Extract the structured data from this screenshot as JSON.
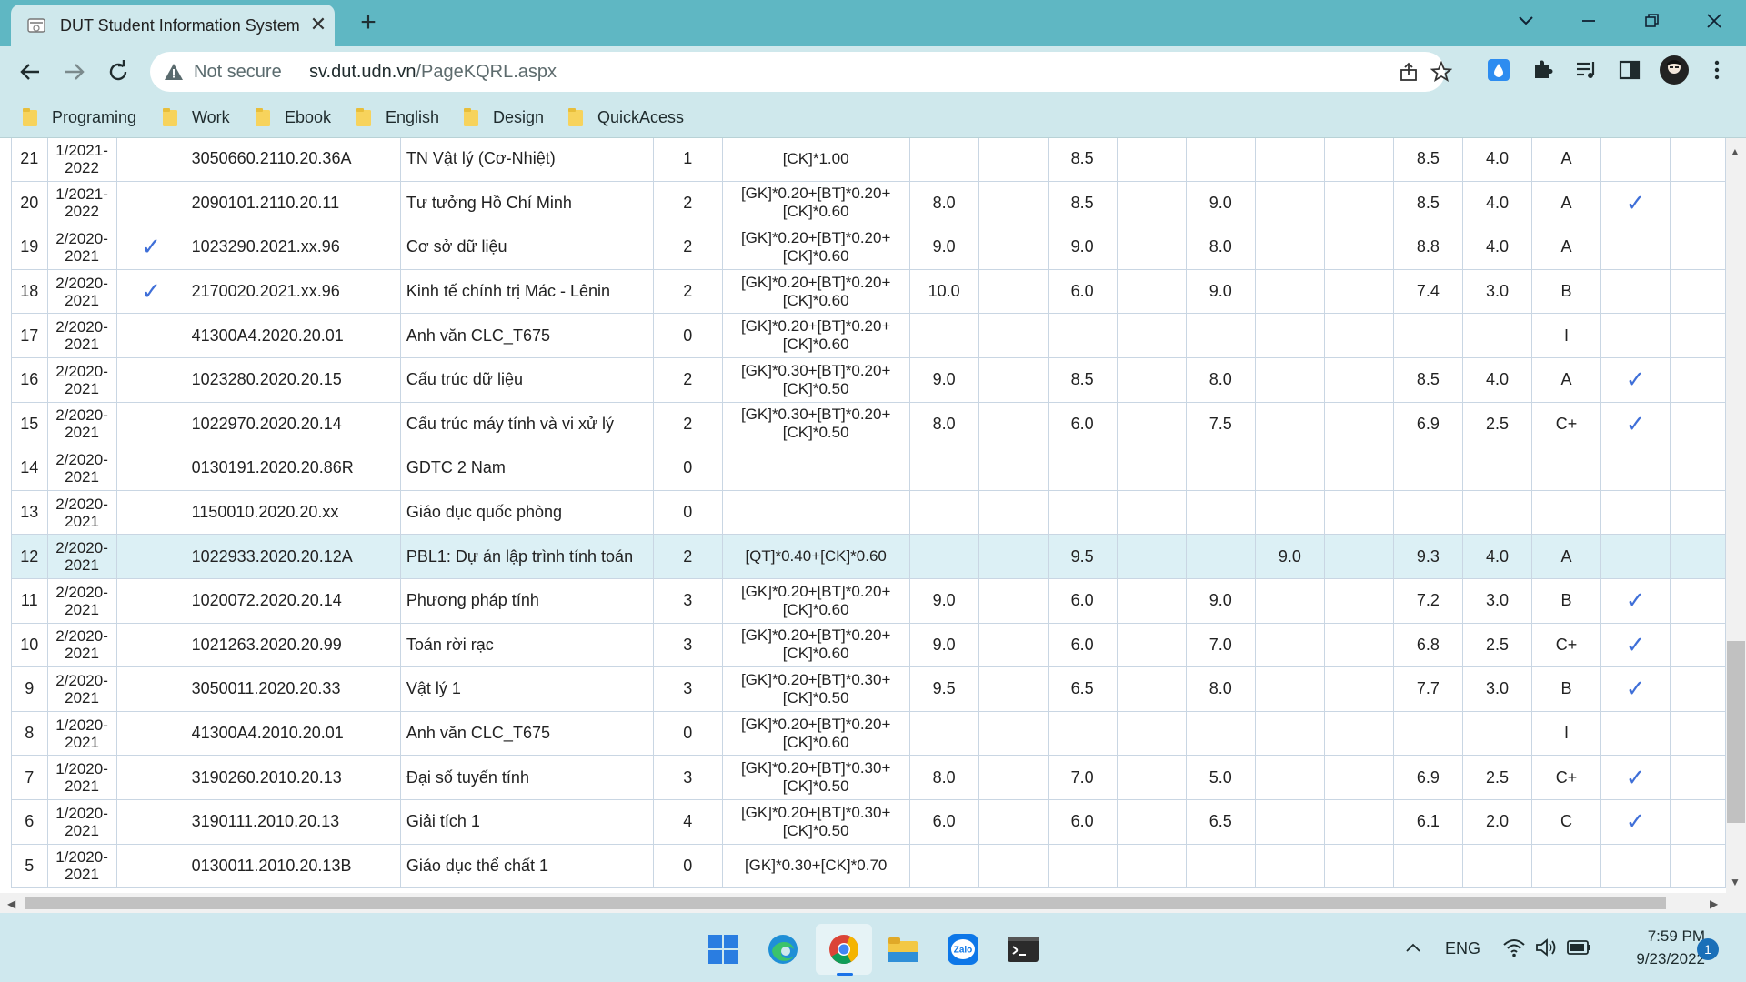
{
  "browser": {
    "tab_title": "DUT Student Information System",
    "new_tab": "+",
    "security_label": "Not secure",
    "url_host": "sv.dut.udn.vn",
    "url_path": "/PageKQRL.aspx"
  },
  "bookmarks": [
    {
      "label": "Programing"
    },
    {
      "label": "Work"
    },
    {
      "label": "Ebook"
    },
    {
      "label": "English"
    },
    {
      "label": "Design"
    },
    {
      "label": "QuickAcess"
    }
  ],
  "grades_table": {
    "rows": [
      {
        "stt": "21",
        "semester": "1/2021-2022",
        "chk1": "",
        "code": "3050660.2110.20.36A",
        "name": "TN Vật lý (Cơ-Nhiệt)",
        "credits": "1",
        "formula": "[CK]*1.00",
        "c1": "",
        "c2": "",
        "c3": "8.5",
        "c4": "",
        "c5": "",
        "c6": "",
        "c7": "",
        "t10": "8.5",
        "t4": "4.0",
        "letter": "A",
        "chk2": ""
      },
      {
        "stt": "20",
        "semester": "1/2021-2022",
        "chk1": "",
        "code": "2090101.2110.20.11",
        "name": "Tư tưởng Hồ Chí Minh",
        "credits": "2",
        "formula": "[GK]*0.20+[BT]*0.20+[CK]*0.60",
        "c1": "8.0",
        "c2": "",
        "c3": "8.5",
        "c4": "",
        "c5": "9.0",
        "c6": "",
        "c7": "",
        "t10": "8.5",
        "t4": "4.0",
        "letter": "A",
        "chk2": "✓"
      },
      {
        "stt": "19",
        "semester": "2/2020-2021",
        "chk1": "✓",
        "code": "1023290.2021.xx.96",
        "name": "Cơ sở dữ liệu",
        "credits": "2",
        "formula": "[GK]*0.20+[BT]*0.20+[CK]*0.60",
        "c1": "9.0",
        "c2": "",
        "c3": "9.0",
        "c4": "",
        "c5": "8.0",
        "c6": "",
        "c7": "",
        "t10": "8.8",
        "t4": "4.0",
        "letter": "A",
        "chk2": ""
      },
      {
        "stt": "18",
        "semester": "2/2020-2021",
        "chk1": "✓",
        "code": "2170020.2021.xx.96",
        "name": "Kinh tế chính trị Mác - Lênin",
        "credits": "2",
        "formula": "[GK]*0.20+[BT]*0.20+[CK]*0.60",
        "c1": "10.0",
        "c2": "",
        "c3": "6.0",
        "c4": "",
        "c5": "9.0",
        "c6": "",
        "c7": "",
        "t10": "7.4",
        "t4": "3.0",
        "letter": "B",
        "chk2": ""
      },
      {
        "stt": "17",
        "semester": "2/2020-2021",
        "chk1": "",
        "code": "41300A4.2020.20.01",
        "name": "Anh văn CLC_T675",
        "credits": "0",
        "formula": "[GK]*0.20+[BT]*0.20+[CK]*0.60",
        "c1": "",
        "c2": "",
        "c3": "",
        "c4": "",
        "c5": "",
        "c6": "",
        "c7": "",
        "t10": "",
        "t4": "",
        "letter": "I",
        "chk2": ""
      },
      {
        "stt": "16",
        "semester": "2/2020-2021",
        "chk1": "",
        "code": "1023280.2020.20.15",
        "name": "Cấu trúc dữ liệu",
        "credits": "2",
        "formula": "[GK]*0.30+[BT]*0.20+[CK]*0.50",
        "c1": "9.0",
        "c2": "",
        "c3": "8.5",
        "c4": "",
        "c5": "8.0",
        "c6": "",
        "c7": "",
        "t10": "8.5",
        "t4": "4.0",
        "letter": "A",
        "chk2": "✓"
      },
      {
        "stt": "15",
        "semester": "2/2020-2021",
        "chk1": "",
        "code": "1022970.2020.20.14",
        "name": "Cấu trúc máy tính và vi xử lý",
        "credits": "2",
        "formula": "[GK]*0.30+[BT]*0.20+[CK]*0.50",
        "c1": "8.0",
        "c2": "",
        "c3": "6.0",
        "c4": "",
        "c5": "7.5",
        "c6": "",
        "c7": "",
        "t10": "6.9",
        "t4": "2.5",
        "letter": "C+",
        "chk2": "✓"
      },
      {
        "stt": "14",
        "semester": "2/2020-2021",
        "chk1": "",
        "code": "0130191.2020.20.86R",
        "name": "GDTC 2 Nam",
        "credits": "0",
        "formula": "",
        "c1": "",
        "c2": "",
        "c3": "",
        "c4": "",
        "c5": "",
        "c6": "",
        "c7": "",
        "t10": "",
        "t4": "",
        "letter": "",
        "chk2": ""
      },
      {
        "stt": "13",
        "semester": "2/2020-2021",
        "chk1": "",
        "code": "1150010.2020.20.xx",
        "name": "Giáo dục quốc phòng",
        "credits": "0",
        "formula": "",
        "c1": "",
        "c2": "",
        "c3": "",
        "c4": "",
        "c5": "",
        "c6": "",
        "c7": "",
        "t10": "",
        "t4": "",
        "letter": "",
        "chk2": ""
      },
      {
        "stt": "12",
        "semester": "2/2020-2021",
        "chk1": "",
        "code": "1022933.2020.20.12A",
        "name": "PBL1: Dự án lập trình tính toán",
        "credits": "2",
        "formula": "[QT]*0.40+[CK]*0.60",
        "c1": "",
        "c2": "",
        "c3": "9.5",
        "c4": "",
        "c5": "",
        "c6": "9.0",
        "c7": "",
        "t10": "9.3",
        "t4": "4.0",
        "letter": "A",
        "chk2": "",
        "highlight": true
      },
      {
        "stt": "11",
        "semester": "2/2020-2021",
        "chk1": "",
        "code": "1020072.2020.20.14",
        "name": "Phương pháp tính",
        "credits": "3",
        "formula": "[GK]*0.20+[BT]*0.20+[CK]*0.60",
        "c1": "9.0",
        "c2": "",
        "c3": "6.0",
        "c4": "",
        "c5": "9.0",
        "c6": "",
        "c7": "",
        "t10": "7.2",
        "t4": "3.0",
        "letter": "B",
        "chk2": "✓"
      },
      {
        "stt": "10",
        "semester": "2/2020-2021",
        "chk1": "",
        "code": "1021263.2020.20.99",
        "name": "Toán rời rạc",
        "credits": "3",
        "formula": "[GK]*0.20+[BT]*0.20+[CK]*0.60",
        "c1": "9.0",
        "c2": "",
        "c3": "6.0",
        "c4": "",
        "c5": "7.0",
        "c6": "",
        "c7": "",
        "t10": "6.8",
        "t4": "2.5",
        "letter": "C+",
        "chk2": "✓"
      },
      {
        "stt": "9",
        "semester": "2/2020-2021",
        "chk1": "",
        "code": "3050011.2020.20.33",
        "name": "Vật lý 1",
        "credits": "3",
        "formula": "[GK]*0.20+[BT]*0.30+[CK]*0.50",
        "c1": "9.5",
        "c2": "",
        "c3": "6.5",
        "c4": "",
        "c5": "8.0",
        "c6": "",
        "c7": "",
        "t10": "7.7",
        "t4": "3.0",
        "letter": "B",
        "chk2": "✓"
      },
      {
        "stt": "8",
        "semester": "1/2020-2021",
        "chk1": "",
        "code": "41300A4.2010.20.01",
        "name": "Anh văn CLC_T675",
        "credits": "0",
        "formula": "[GK]*0.20+[BT]*0.20+[CK]*0.60",
        "c1": "",
        "c2": "",
        "c3": "",
        "c4": "",
        "c5": "",
        "c6": "",
        "c7": "",
        "t10": "",
        "t4": "",
        "letter": "I",
        "chk2": ""
      },
      {
        "stt": "7",
        "semester": "1/2020-2021",
        "chk1": "",
        "code": "3190260.2010.20.13",
        "name": "Đại số tuyến tính",
        "credits": "3",
        "formula": "[GK]*0.20+[BT]*0.30+[CK]*0.50",
        "c1": "8.0",
        "c2": "",
        "c3": "7.0",
        "c4": "",
        "c5": "5.0",
        "c6": "",
        "c7": "",
        "t10": "6.9",
        "t4": "2.5",
        "letter": "C+",
        "chk2": "✓"
      },
      {
        "stt": "6",
        "semester": "1/2020-2021",
        "chk1": "",
        "code": "3190111.2010.20.13",
        "name": "Giải tích 1",
        "credits": "4",
        "formula": "[GK]*0.20+[BT]*0.30+[CK]*0.50",
        "c1": "6.0",
        "c2": "",
        "c3": "6.0",
        "c4": "",
        "c5": "6.5",
        "c6": "",
        "c7": "",
        "t10": "6.1",
        "t4": "2.0",
        "letter": "C",
        "chk2": "✓"
      },
      {
        "stt": "5",
        "semester": "1/2020-2021",
        "chk1": "",
        "code": "0130011.2010.20.13B",
        "name": "Giáo dục thể chất 1",
        "credits": "0",
        "formula": "[GK]*0.30+[CK]*0.70",
        "c1": "",
        "c2": "",
        "c3": "",
        "c4": "",
        "c5": "",
        "c6": "",
        "c7": "",
        "t10": "",
        "t4": "",
        "letter": "",
        "chk2": ""
      }
    ]
  },
  "taskbar": {
    "language": "ENG",
    "time": "7:59 PM",
    "date": "9/23/2022",
    "notification_count": "1"
  },
  "colors": {
    "tab_strip": "#5fb7c3",
    "toolbar": "#cfe8ec",
    "highlight_row": "#dcf0f5",
    "check": "#3f6fd8"
  }
}
